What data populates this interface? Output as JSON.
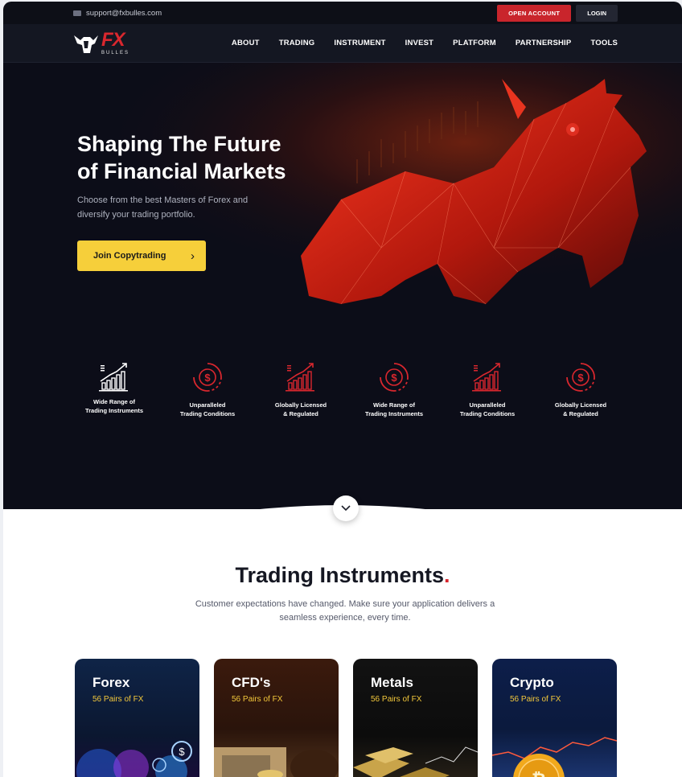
{
  "topbar": {
    "email": "support@fxbulles.com",
    "open_account": "OPEN ACCOUNT",
    "login": "LOGIN"
  },
  "brand": {
    "name": "FX",
    "sub": "BULLES"
  },
  "nav": {
    "items": [
      "ABOUT",
      "TRADING",
      "INSTRUMENT",
      "INVEST",
      "PLATFORM",
      "PARTNERSHIP",
      "TOOLS"
    ]
  },
  "hero": {
    "title_line1": "Shaping The Future",
    "title_line2": "of Financial Markets",
    "text_line1": "Choose from the best Masters of Forex and",
    "text_line2": "diversify your trading portfolio.",
    "cta": "Join Copytrading"
  },
  "features": [
    {
      "line1": "Wide Range of",
      "line2": "Trading Instruments",
      "icon": "chart-growth-icon"
    },
    {
      "line1": "Unparalleled",
      "line2": "Trading Conditions",
      "icon": "dollar-cycle-icon"
    },
    {
      "line1": "Globally Licensed",
      "line2": "& Regulated",
      "icon": "chart-growth-icon"
    },
    {
      "line1": "Wide Range of",
      "line2": "Trading Instruments",
      "icon": "dollar-cycle-icon"
    },
    {
      "line1": "Unparalleled",
      "line2": "Trading Conditions",
      "icon": "chart-growth-icon"
    },
    {
      "line1": "Globally Licensed",
      "line2": "& Regulated",
      "icon": "dollar-cycle-icon"
    }
  ],
  "section": {
    "title": "Trading Instruments",
    "dot": ".",
    "sub_line1": "Customer expectations have changed. Make sure your application  delivers a",
    "sub_line2": "seamless experience, every time."
  },
  "cards": [
    {
      "title": "Forex",
      "sub": "56 Pairs of FX"
    },
    {
      "title": "CFD's",
      "sub": "56 Pairs of FX"
    },
    {
      "title": "Metals",
      "sub": "56 Pairs of FX"
    },
    {
      "title": "Crypto",
      "sub": "56 Pairs of FX"
    }
  ],
  "colors": {
    "accent_red": "#d9272e",
    "cta_yellow": "#f6cf3a",
    "hero_bg": "#0c0d18"
  }
}
